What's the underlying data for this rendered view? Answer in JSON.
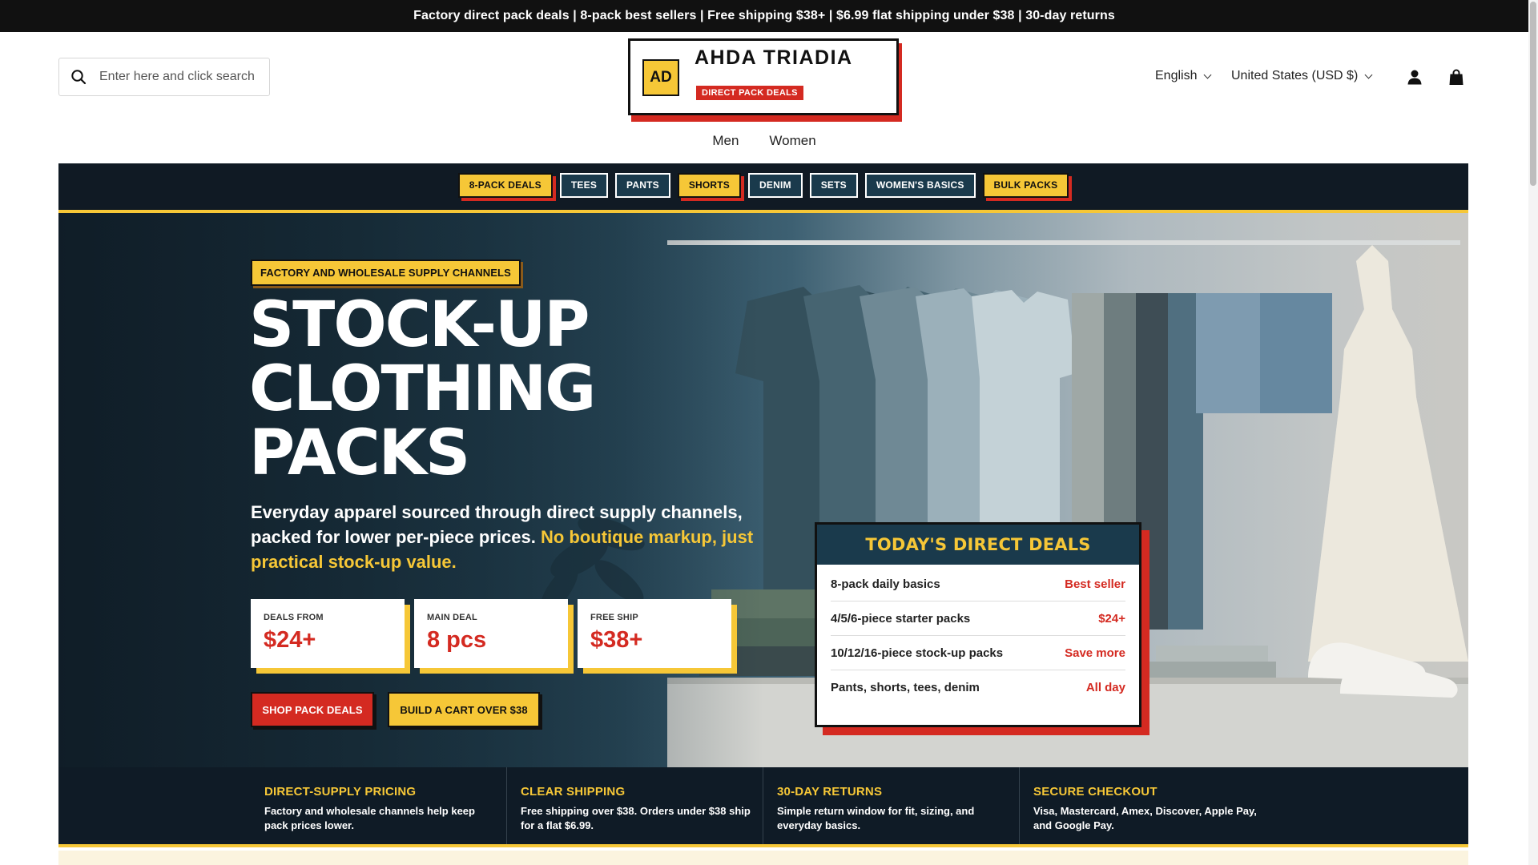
{
  "announcement": "Factory direct pack deals | 8-pack best sellers | Free shipping $38+ | $6.99 flat shipping under $38 | 30-day returns",
  "header": {
    "search_placeholder": "Enter here and click search",
    "logo": {
      "mark": "AD",
      "name": "AHDA TRIADIA",
      "tag": "DIRECT PACK DEALS"
    },
    "language": "English",
    "currency": "United States (USD $)",
    "account_icon": "user-icon",
    "cart_icon": "shopping-bag-icon"
  },
  "main_nav": [
    "Men",
    "Women"
  ],
  "categories": [
    {
      "label": "8-PACK DEALS",
      "style": "yellow"
    },
    {
      "label": "TEES",
      "style": "dark"
    },
    {
      "label": "PANTS",
      "style": "dark"
    },
    {
      "label": "SHORTS",
      "style": "yellow"
    },
    {
      "label": "DENIM",
      "style": "dark"
    },
    {
      "label": "SETS",
      "style": "dark"
    },
    {
      "label": "WOMEN'S BASICS",
      "style": "dark"
    },
    {
      "label": "BULK PACKS",
      "style": "yellow"
    }
  ],
  "hero": {
    "eyebrow": "FACTORY AND WHOLESALE SUPPLY CHANNELS",
    "headline": [
      "STOCK-UP",
      "CLOTHING",
      "PACKS"
    ],
    "sub_main": "Everyday apparel sourced through direct supply channels, packed for lower per-piece prices.",
    "sub_highlight": "No boutique markup, just practical stock-up value.",
    "stats": [
      {
        "label": "DEALS FROM",
        "value": "$24+"
      },
      {
        "label": "MAIN DEAL",
        "value": "8 pcs"
      },
      {
        "label": "FREE SHIP",
        "value": "$38+"
      }
    ],
    "primary_button": "SHOP PACK DEALS",
    "secondary_button": "BUILD A CART OVER $38"
  },
  "deals_card": {
    "title": "TODAY'S DIRECT DEALS",
    "rows": [
      {
        "item": "8-pack daily basics",
        "tag": "Best seller"
      },
      {
        "item": "4/5/6-piece starter packs",
        "tag": "$24+"
      },
      {
        "item": "10/12/16-piece stock-up packs",
        "tag": "Save more"
      },
      {
        "item": "Pants, shorts, tees, denim",
        "tag": "All day"
      }
    ]
  },
  "features": [
    {
      "title": "DIRECT-SUPPLY PRICING",
      "desc": "Factory and wholesale channels help keep pack prices lower."
    },
    {
      "title": "CLEAR SHIPPING",
      "desc": "Free shipping over $38. Orders under $38 ship for a flat $6.99."
    },
    {
      "title": "30-DAY RETURNS",
      "desc": "Simple return window for fit, sizing, and everyday basics."
    },
    {
      "title": "SECURE CHECKOUT",
      "desc": "Visa, Mastercard, Amex, Discover, Apple Pay, and Google Pay."
    }
  ],
  "colors": {
    "accent_yellow": "#f6c737",
    "accent_red": "#d42a21",
    "navy": "#1a3a4c",
    "dark": "#101a24"
  }
}
